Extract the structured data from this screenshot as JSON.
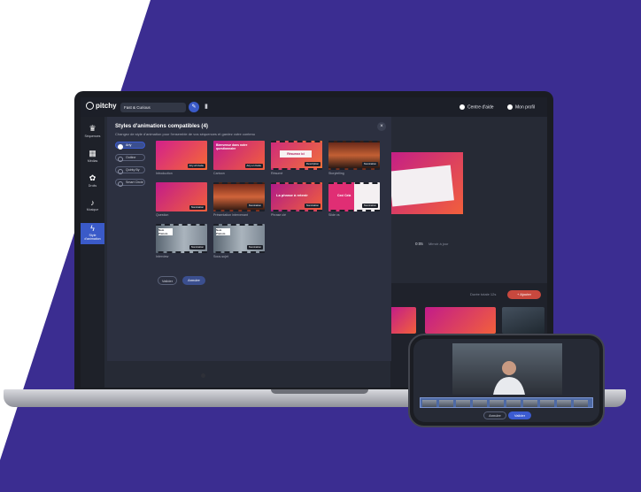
{
  "app": {
    "logo": "pitchy",
    "project_name": "Fast & Curious",
    "help": "Centre d'aide",
    "profile": "Mon profil"
  },
  "sidebar": {
    "items": [
      {
        "label": "Séquences",
        "icon": "crown-icon"
      },
      {
        "label": "Médias",
        "icon": "media-icon"
      },
      {
        "label": "Droits",
        "icon": "palette-icon"
      },
      {
        "label": "Musique",
        "icon": "music-icon"
      },
      {
        "label": "Style d'animation",
        "icon": "lightning-icon"
      }
    ]
  },
  "modal": {
    "title": "Styles d'animations compatibles (4)",
    "subtitle": "Changez de style d'animation pour l'ensemble de vos séquences et gardez votre contenu",
    "filters": [
      "Arty",
      "Outline",
      "Quirky By",
      "Smart Circle"
    ],
    "templates": [
      {
        "label": "Introduction",
        "tag": "Arty ah Carte",
        "text": ""
      },
      {
        "label": "Cartoon",
        "tag": "Arty en Carte",
        "text": "Bienvenue dans notre questionnaire"
      },
      {
        "label": "Résumé",
        "tag": "Description",
        "text": "Résumez ici"
      },
      {
        "label": "Storytelling",
        "tag": "Nomination",
        "text": ""
      },
      {
        "label": "Question",
        "tag": "Nomination",
        "text": ""
      },
      {
        "label": "Présentation intervenant",
        "tag": "Nomination",
        "text": ""
      },
      {
        "label": "Phrase clé",
        "tag": "Nomination",
        "text": "La phrase à retenir"
      },
      {
        "label": "Slide vs",
        "tag": "Nomination",
        "text": "Ceci Cela"
      },
      {
        "label": "Interview",
        "tag": "Nomination",
        "text": "Nom Prénom"
      },
      {
        "label": "Sous-sujet",
        "tag": "Nomination",
        "text": "Nom Prénom"
      }
    ],
    "validate": "Valider",
    "cancel": "Annuler"
  },
  "editor": {
    "time": "0:05",
    "mirror": "Mirroir à jour",
    "add": "+ Ajouter",
    "duration": "Durée totale 12s"
  },
  "phone": {
    "cancel": "Annuler",
    "validate": "Valider"
  }
}
